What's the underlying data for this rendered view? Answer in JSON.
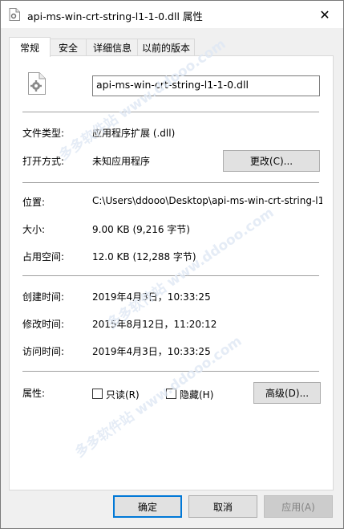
{
  "window": {
    "title": "api-ms-win-crt-string-l1-1-0.dll 属性",
    "close_glyph": "✕"
  },
  "tabs": [
    {
      "label": "常规",
      "active": true
    },
    {
      "label": "安全",
      "active": false
    },
    {
      "label": "详细信息",
      "active": false
    },
    {
      "label": "以前的版本",
      "active": false
    }
  ],
  "file": {
    "name": "api-ms-win-crt-string-l1-1-0.dll",
    "icon": "dll-file-gear-icon"
  },
  "type_info": {
    "file_type_label": "文件类型:",
    "file_type_value": "应用程序扩展 (.dll)",
    "open_with_label": "打开方式:",
    "open_with_value": "未知应用程序",
    "change_button": "更改(C)..."
  },
  "location_info": {
    "location_label": "位置:",
    "location_value": "C:\\Users\\ddooo\\Desktop\\api-ms-win-crt-string-l1",
    "size_label": "大小:",
    "size_value": "9.00 KB (9,216 字节)",
    "size_on_disk_label": "占用空间:",
    "size_on_disk_value": "12.0 KB (12,288 字节)"
  },
  "dates": {
    "created_label": "创建时间:",
    "created_value": "2019年4月3日，10:33:25",
    "modified_label": "修改时间:",
    "modified_value": "2015年8月12日，11:20:12",
    "accessed_label": "访问时间:",
    "accessed_value": "2019年4月3日，10:33:25"
  },
  "attributes": {
    "label": "属性:",
    "readonly_label": "只读(R)",
    "readonly_checked": false,
    "hidden_label": "隐藏(H)",
    "hidden_checked": false,
    "advanced_button": "高级(D)..."
  },
  "footer": {
    "ok": "确定",
    "cancel": "取消",
    "apply": "应用(A)"
  },
  "watermark": "多多软件站 www.ddooo.com",
  "colors": {
    "accent": "#0078d7",
    "separator": "#a0a0a0"
  }
}
